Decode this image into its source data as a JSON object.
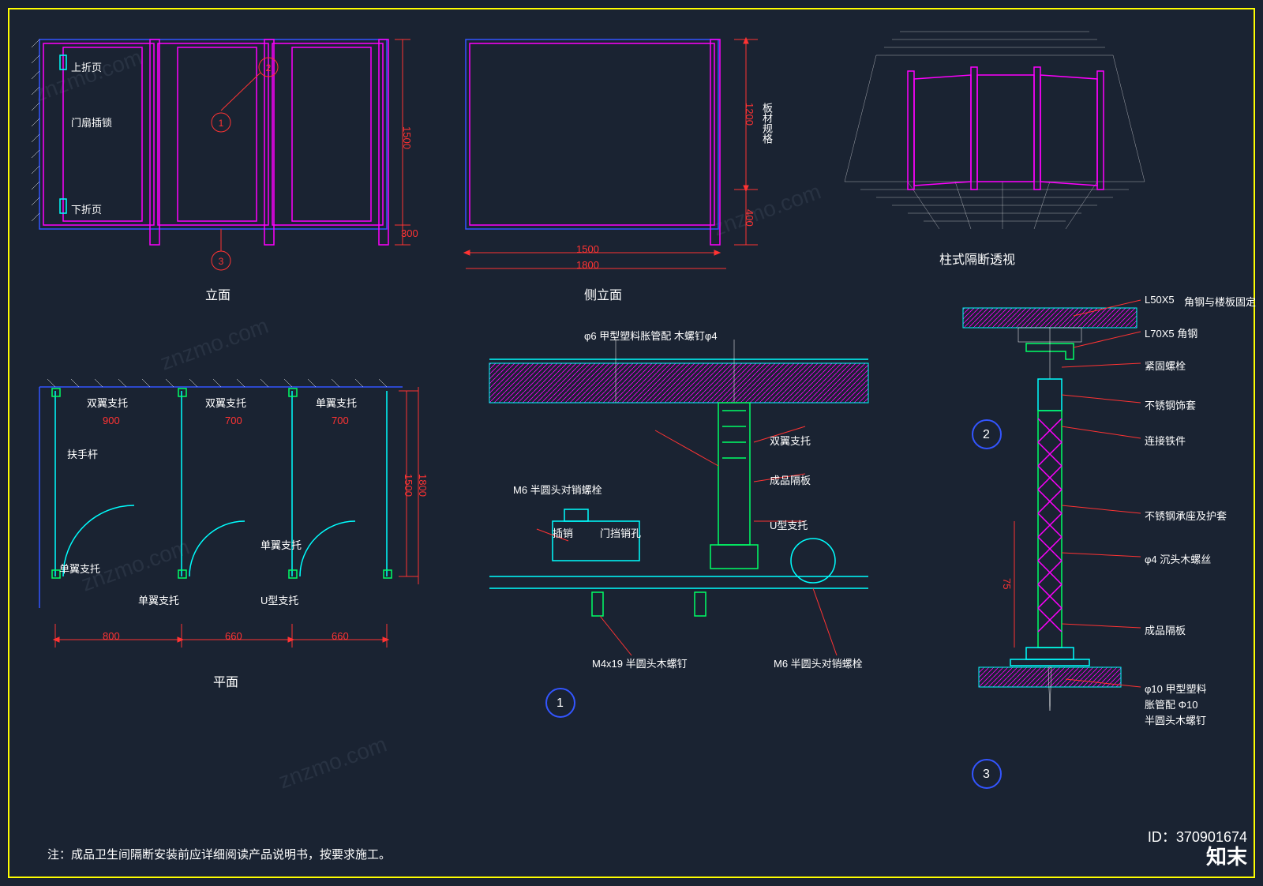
{
  "views": {
    "elevation": {
      "title": "立面"
    },
    "side_elevation": {
      "title": "侧立面"
    },
    "perspective": {
      "title": "柱式隔断透视"
    },
    "plan": {
      "title": "平面"
    }
  },
  "elevation_labels": {
    "upper_hinge": "上折页",
    "door_latch": "门扇插锁",
    "lower_hinge": "下折页"
  },
  "elevation_dims": {
    "h_main": "1500",
    "h_gap": "300",
    "h_rot": "板材规格"
  },
  "side_dims": {
    "h_main": "1200",
    "h_gap": "400",
    "w_inner": "1500",
    "w_outer": "1800",
    "h_rot": "板材规格"
  },
  "plan_labels": {
    "double_support_1": "双翼支托",
    "double_support_2": "双翼支托",
    "single_support_1": "单翼支托",
    "single_support_2": "单翼支托",
    "single_support_3": "单翼支托",
    "single_support_4": "单翼支托",
    "u_support": "U型支托",
    "handrail": "扶手杆"
  },
  "plan_dims": {
    "w1": "900",
    "w2": "700",
    "w3": "700",
    "d1": "800",
    "d2": "660",
    "d3": "660",
    "depth1": "1500",
    "depth2": "1800"
  },
  "detail1_labels": {
    "top_note": "φ6 甲型塑料胀管配 木螺钉φ4",
    "l1": "M6 半圆头对销螺栓",
    "l2": "插销",
    "l3": "门挡销孔",
    "l4": "双翼支托",
    "l5": "成品隔板",
    "l6": "U型支托",
    "b1": "M4x19  半圆头木螺钉",
    "b2": "M6 半圆头对销螺栓"
  },
  "detail2_labels": {
    "r1": "L50X5",
    "r1b": "角钢与楼板固定",
    "r2": "L70X5  角钢",
    "r3": "紧固螺栓",
    "r4": "不锈钢饰套",
    "r5": "连接铁件",
    "r6": "不锈钢承座及护套",
    "r7": "φ4 沉头木螺丝",
    "r8": "成品隔板",
    "r9": "φ10 甲型塑料",
    "r10": "胀管配 Φ10",
    "r11": "半圆头木螺钉",
    "dim75": "75"
  },
  "detail_marks": {
    "d1": "1",
    "d2": "2",
    "d3": "3"
  },
  "note_text": "注：成品卫生间隔断安装前应详细阅读产品说明书，按要求施工。",
  "brand_logo": "知末",
  "brand_id": "ID：370901674",
  "watermark": "znzmo.com"
}
